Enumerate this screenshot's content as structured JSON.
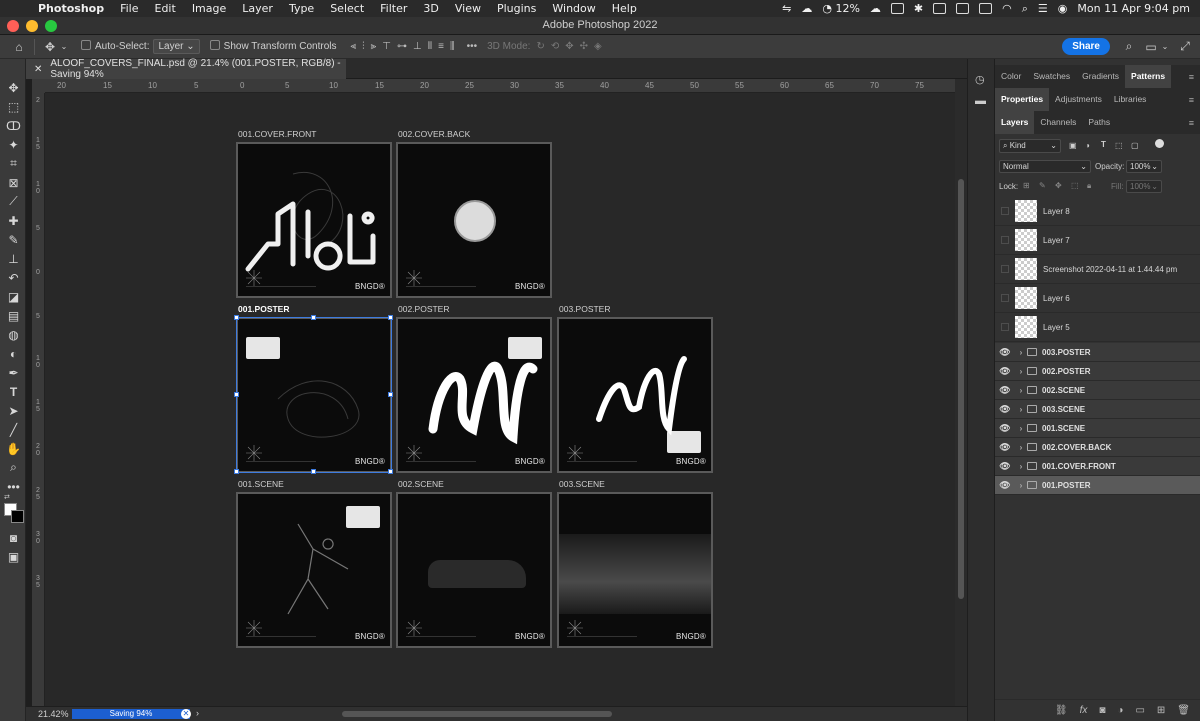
{
  "menubar": {
    "app": "Photoshop",
    "items": [
      "File",
      "Edit",
      "Image",
      "Layer",
      "Type",
      "Select",
      "Filter",
      "3D",
      "View",
      "Plugins",
      "Window",
      "Help"
    ],
    "battery": "12%",
    "datetime": "Mon 11 Apr  9:04 pm"
  },
  "window": {
    "title": "Adobe Photoshop 2022"
  },
  "options": {
    "auto_select_label": "Auto-Select:",
    "auto_select_value": "Layer",
    "transform_label": "Show Transform Controls",
    "mode3d_label": "3D Mode:",
    "share_label": "Share"
  },
  "document": {
    "tab_title": "ALOOF_COVERS_FINAL.psd @ 21.4% (001.POSTER, RGB/8) - Saving 94%"
  },
  "rulers": {
    "h": [
      "20",
      "15",
      "10",
      "5",
      "0",
      "5",
      "10",
      "15",
      "20",
      "25",
      "30",
      "35",
      "40",
      "45",
      "50",
      "55",
      "60",
      "65",
      "70",
      "75"
    ],
    "v": [
      "2",
      "1 5",
      "1 0",
      "5",
      "0",
      "5",
      "1 0",
      "1 5",
      "2 0",
      "2 5",
      "3 0",
      "3 5"
    ]
  },
  "artboards": [
    {
      "label": "001.COVER.FRONT",
      "brand": "BNGD®"
    },
    {
      "label": "002.COVER.BACK",
      "brand": "BNGD®"
    },
    {
      "label": "001.POSTER",
      "brand": "BNGD®"
    },
    {
      "label": "002.POSTER",
      "brand": "BNGD®"
    },
    {
      "label": "003.POSTER",
      "brand": "BNGD®"
    },
    {
      "label": "001.SCENE",
      "brand": "BNGD®"
    },
    {
      "label": "002.SCENE",
      "brand": "BNGD®"
    },
    {
      "label": "003.SCENE",
      "brand": "BNGD®"
    }
  ],
  "status": {
    "zoom": "21.42%",
    "progress_label": "Saving 94%",
    "progress": 0.94
  },
  "panels": {
    "top_tabs": [
      "Color",
      "Swatches",
      "Gradients",
      "Patterns"
    ],
    "mid_tabs": [
      "Properties",
      "Adjustments",
      "Libraries"
    ],
    "layer_tabs": [
      "Layers",
      "Channels",
      "Paths"
    ],
    "kind_filter": "Kind",
    "blend_mode": "Normal",
    "opacity_label": "Opacity:",
    "opacity_value": "100%",
    "lock_label": "Lock:",
    "fill_label": "Fill:",
    "fill_value": "100%",
    "layers": [
      {
        "name": "Layer 8"
      },
      {
        "name": "Layer 7"
      },
      {
        "name": "Screenshot 2022-04-11 at 1.44.44 pm"
      },
      {
        "name": "Layer 6"
      },
      {
        "name": "Layer 5"
      }
    ],
    "groups": [
      {
        "name": "003.POSTER"
      },
      {
        "name": "002.POSTER"
      },
      {
        "name": "002.SCENE"
      },
      {
        "name": "003.SCENE"
      },
      {
        "name": "001.SCENE"
      },
      {
        "name": "002.COVER.BACK"
      },
      {
        "name": "001.COVER.FRONT"
      },
      {
        "name": "001.POSTER"
      }
    ]
  },
  "colors": {
    "accent": "#1473e6",
    "selection": "#3d7be0",
    "canvas_bg": "#282828",
    "panel_bg": "#323232"
  }
}
